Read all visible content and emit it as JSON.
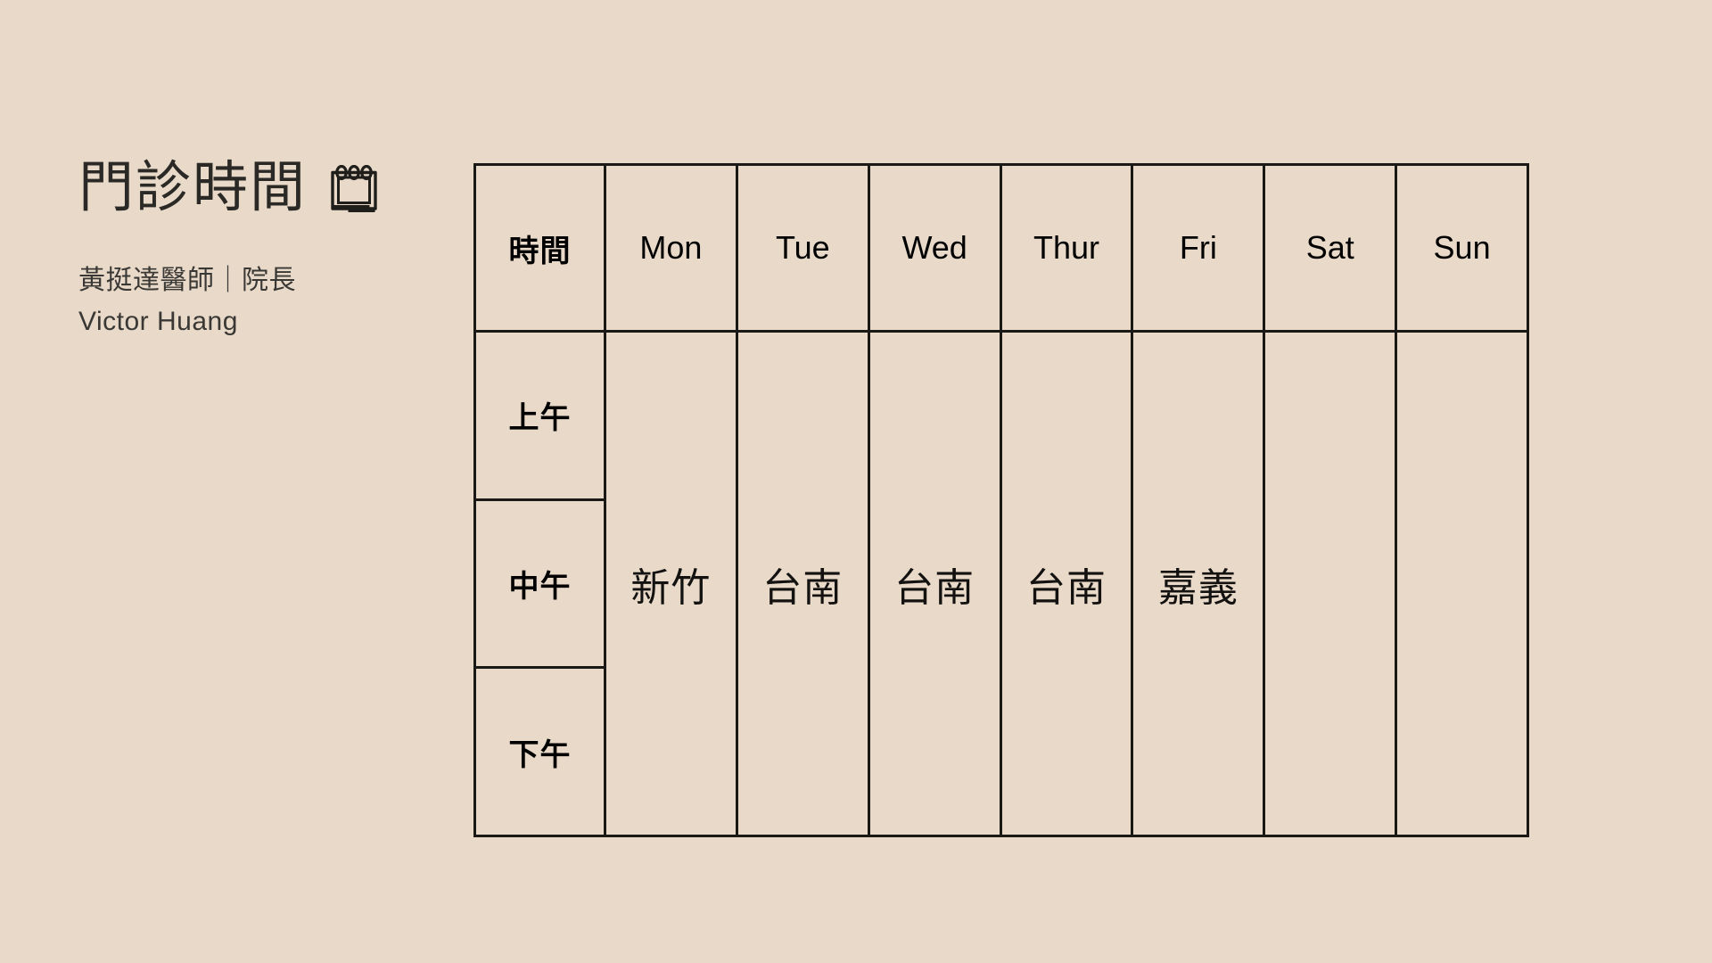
{
  "colors": {
    "background": "#E8D9C8",
    "border": "#1A1916",
    "title_text": "#2B2926",
    "subtitle_text": "#3A3835",
    "cell_text": "#131210"
  },
  "header": {
    "title": "門診時間",
    "icon": "calendar-icon",
    "subtitle_line1": "黃挺達醫師｜院長",
    "subtitle_line2": "Victor Huang"
  },
  "table": {
    "time_header": "時間",
    "day_headers": [
      "Mon",
      "Tue",
      "Wed",
      "Thur",
      "Fri",
      "Sat",
      "Sun"
    ],
    "time_rows": [
      "上午",
      "中午",
      "下午"
    ],
    "day_values": [
      "新竹",
      "台南",
      "台南",
      "台南",
      "嘉義",
      "",
      ""
    ]
  }
}
